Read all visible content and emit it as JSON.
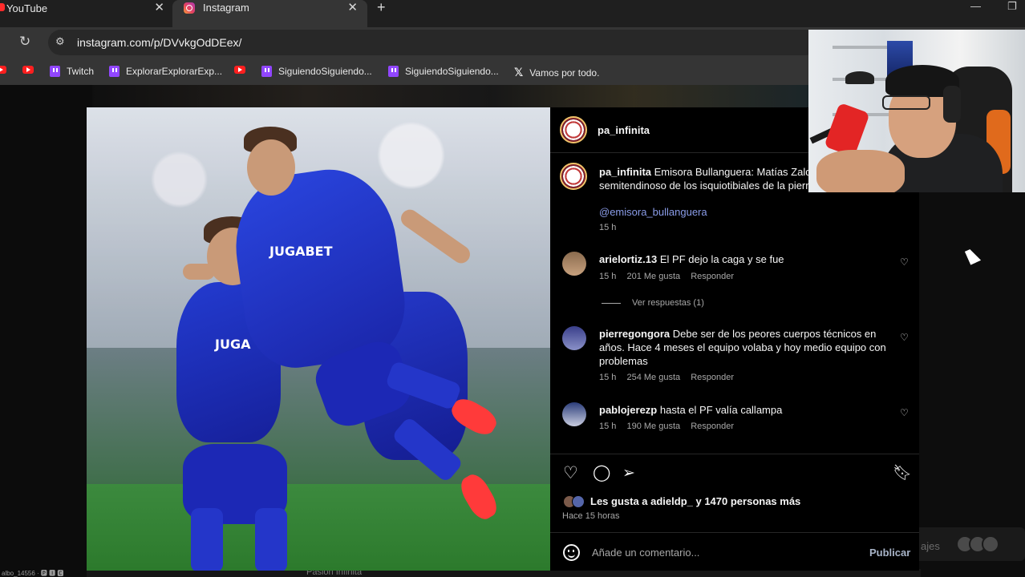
{
  "browser": {
    "tabs": [
      {
        "title": "YouTube",
        "active": false
      },
      {
        "title": "Instagram",
        "active": true
      }
    ],
    "url": "instagram.com/p/DVvkgOdDEex/",
    "bookmarks": [
      {
        "label": "",
        "icon": "youtube-icon"
      },
      {
        "label": "",
        "icon": "youtube-icon"
      },
      {
        "label": "Twitch",
        "icon": "twitch-icon"
      },
      {
        "label": "ExplorarExplorarExp...",
        "icon": "twitch-icon"
      },
      {
        "label": "",
        "icon": "youtube-icon"
      },
      {
        "label": "SiguiendoSiguiendo...",
        "icon": "twitch-icon"
      },
      {
        "label": "SiguiendoSiguiendo...",
        "icon": "twitch-icon"
      },
      {
        "label": "Vamos por todo.",
        "icon": "x-icon"
      }
    ]
  },
  "post": {
    "author": "pa_infinita",
    "image_sponsor_1": "JUGABET",
    "image_sponsor_2": "JUGA",
    "caption": {
      "username": "pa_infinita",
      "text": "Emisora Bullanguera: Matías Zaldiv",
      "text_line2": "semitendinoso de los isquiotibiales de la pierr",
      "mention": "@emisora_bullanguera",
      "time": "15 h"
    },
    "comments": [
      {
        "username": "arielortiz.13",
        "text": "El PF dejo la caga y se fue",
        "time": "15 h",
        "likes": "201 Me gusta",
        "reply": "Responder"
      },
      {
        "username": "pierregongora",
        "text": "Debe ser de los peores cuerpos técnicos en años. Hace 4 meses el equipo volaba y hoy medio equipo con problemas",
        "time": "15 h",
        "likes": "254 Me gusta",
        "reply": "Responder"
      },
      {
        "username": "pablojerezp",
        "text": "hasta el PF valía callampa",
        "time": "15 h",
        "likes": "190 Me gusta",
        "reply": "Responder"
      }
    ],
    "view_replies": "Ver respuestas (1)",
    "likes_text": "Les gusta a adieldp_ y 1470 personas más",
    "posted_ago": "Hace 15 horas",
    "comment_placeholder": "Añade un comentario...",
    "publish_label": "Publicar"
  },
  "background": {
    "bottom_text": "Pasión Infinita",
    "right_text": "ajes",
    "corner_text": "albo_14556 · 🅿 🅸 🅲"
  },
  "colors": {
    "instagram_bg": "#000000",
    "mention": "#8a9ce8",
    "twitch": "#9146ff",
    "youtube": "#ff1f1f"
  }
}
